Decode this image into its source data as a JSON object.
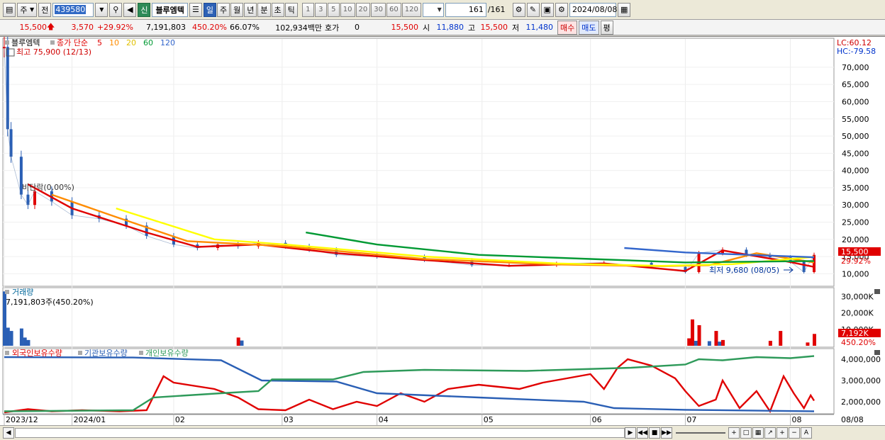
{
  "toolbar": {
    "market": "주",
    "prev_label": "전",
    "code": "439580",
    "badge": "신",
    "stock_name": "블루엠텍",
    "period_buttons": [
      "일",
      "주",
      "월",
      "년",
      "분",
      "초",
      "틱"
    ],
    "active_period": "일",
    "interval_buttons": [
      "1",
      "3",
      "5",
      "10",
      "20",
      "30",
      "60",
      "120"
    ],
    "count": "161",
    "total": "/161",
    "date": "2024/08/08"
  },
  "quote": {
    "price": "15,500",
    "change": "3,570",
    "change_pct": "+29.92%",
    "volume": "7,191,803",
    "volume_ratio": "450.20%",
    "turnover": "66.07%",
    "amount": "102,934백만",
    "hoga_label": "호가",
    "hoga_value": "0",
    "ask": "15,500",
    "open_label": "시",
    "open": "11,880",
    "high_label": "고",
    "high": "15,500",
    "low_label": "저",
    "low": "11,480",
    "buy_label": "매수",
    "sell_label": "매도",
    "avg_label": "평"
  },
  "price_panel": {
    "legend_name": "블루엠텍",
    "legend_ma": "종가 단순",
    "ma_periods": [
      "5",
      "10",
      "20",
      "60",
      "120"
    ],
    "ma_colors": [
      "#e00000",
      "#ff8c00",
      "#ffff00",
      "#009933",
      "#3366cc"
    ],
    "high_note": "최고 75,900 (12/13)",
    "low_note": "최저 9,680 (08/05)",
    "base_note": "비단락(0,00%)",
    "lc": "LC:60.12",
    "hc": "HC:-79.58",
    "price_tag": "15,500",
    "pct_tag": "29.92%"
  },
  "volume_panel": {
    "title": "거래량",
    "value": "7,191,803주(450.20%)",
    "tag": "7,192K",
    "pct_tag": "450.20%"
  },
  "holdings_panel": {
    "series_names": [
      "외국인보유수량",
      "기관보유수량",
      "개인보유수량"
    ]
  },
  "x_axis": {
    "labels": [
      "2023/12",
      "2024/01",
      "02",
      "03",
      "04",
      "05",
      "06",
      "07",
      "08"
    ],
    "right_label": "08/08"
  },
  "chart_data": [
    {
      "type": "candlestick",
      "title": "",
      "ylim": [
        7000,
        78000
      ],
      "y_ticks": [
        "70,000",
        "65,000",
        "60,000",
        "55,000",
        "50,000",
        "45,000",
        "40,000",
        "35,000",
        "30,000",
        "25,000",
        "20,000",
        "15,000",
        "10,000"
      ],
      "y_tick_values": [
        70000,
        65000,
        60000,
        55000,
        50000,
        45000,
        40000,
        35000,
        30000,
        25000,
        20000,
        15000,
        10000
      ],
      "x_start": "2023/12/13",
      "close_path": [
        {
          "d": "2023/12/13",
          "v": 75900
        },
        {
          "d": "2023/12/14",
          "v": 52000
        },
        {
          "d": "2023/12/15",
          "v": 44000
        },
        {
          "d": "2023/12/18",
          "v": 33000
        },
        {
          "d": "2023/12/20",
          "v": 30000
        },
        {
          "d": "2023/12/22",
          "v": 34000
        },
        {
          "d": "2023/12/27",
          "v": 31000
        },
        {
          "d": "2024/01/02",
          "v": 27000
        },
        {
          "d": "2024/01/10",
          "v": 26000
        },
        {
          "d": "2024/01/18",
          "v": 24000
        },
        {
          "d": "2024/01/24",
          "v": 21000
        },
        {
          "d": "2024/02/01",
          "v": 18500
        },
        {
          "d": "2024/02/08",
          "v": 17500
        },
        {
          "d": "2024/02/14",
          "v": 18500
        },
        {
          "d": "2024/02/20",
          "v": 18000
        },
        {
          "d": "2024/02/26",
          "v": 19000
        },
        {
          "d": "2024/03/05",
          "v": 18000
        },
        {
          "d": "2024/03/12",
          "v": 17000
        },
        {
          "d": "2024/03/20",
          "v": 15500
        },
        {
          "d": "2024/04/01",
          "v": 15000
        },
        {
          "d": "2024/04/15",
          "v": 14000
        },
        {
          "d": "2024/04/29",
          "v": 12500
        },
        {
          "d": "2024/05/10",
          "v": 12500
        },
        {
          "d": "2024/05/24",
          "v": 13000
        },
        {
          "d": "2024/06/07",
          "v": 13200
        },
        {
          "d": "2024/06/21",
          "v": 12000
        },
        {
          "d": "2024/07/01",
          "v": 10500
        },
        {
          "d": "2024/07/05",
          "v": 16000
        },
        {
          "d": "2024/07/12",
          "v": 17000
        },
        {
          "d": "2024/07/19",
          "v": 15500
        },
        {
          "d": "2024/07/26",
          "v": 14800
        },
        {
          "d": "2024/08/01",
          "v": 13500
        },
        {
          "d": "2024/08/05",
          "v": 10500
        },
        {
          "d": "2024/08/08",
          "v": 15500
        }
      ],
      "series": [
        {
          "name": "5",
          "color": "#e00000",
          "points": [
            {
              "d": "2023/12/20",
              "v": 36000
            },
            {
              "d": "2024/01/02",
              "v": 29000
            },
            {
              "d": "2024/01/24",
              "v": 22000
            },
            {
              "d": "2024/02/08",
              "v": 17800
            },
            {
              "d": "2024/02/26",
              "v": 18500
            },
            {
              "d": "2024/03/20",
              "v": 16000
            },
            {
              "d": "2024/04/15",
              "v": 14000
            },
            {
              "d": "2024/05/10",
              "v": 12300
            },
            {
              "d": "2024/06/07",
              "v": 13000
            },
            {
              "d": "2024/07/01",
              "v": 10800
            },
            {
              "d": "2024/07/12",
              "v": 16800
            },
            {
              "d": "2024/08/01",
              "v": 13400
            },
            {
              "d": "2024/08/08",
              "v": 12000
            }
          ]
        },
        {
          "name": "10",
          "color": "#ff8c00",
          "points": [
            {
              "d": "2023/12/27",
              "v": 33000
            },
            {
              "d": "2024/01/15",
              "v": 26500
            },
            {
              "d": "2024/02/05",
              "v": 19500
            },
            {
              "d": "2024/03/05",
              "v": 18000
            },
            {
              "d": "2024/04/15",
              "v": 14300
            },
            {
              "d": "2024/05/24",
              "v": 12700
            },
            {
              "d": "2024/06/24",
              "v": 12200
            },
            {
              "d": "2024/07/08",
              "v": 12500
            },
            {
              "d": "2024/07/22",
              "v": 16000
            },
            {
              "d": "2024/08/08",
              "v": 13300
            }
          ]
        },
        {
          "name": "20",
          "color": "#ffff00",
          "points": [
            {
              "d": "2024/01/15",
              "v": 29000
            },
            {
              "d": "2024/02/13",
              "v": 20000
            },
            {
              "d": "2024/03/05",
              "v": 18500
            },
            {
              "d": "2024/04/15",
              "v": 15000
            },
            {
              "d": "2024/05/24",
              "v": 13000
            },
            {
              "d": "2024/06/24",
              "v": 12300
            },
            {
              "d": "2024/07/15",
              "v": 12800
            },
            {
              "d": "2024/08/08",
              "v": 14900
            }
          ]
        },
        {
          "name": "60",
          "color": "#009933",
          "points": [
            {
              "d": "2024/03/11",
              "v": 22000
            },
            {
              "d": "2024/04/01",
              "v": 18500
            },
            {
              "d": "2024/05/01",
              "v": 15500
            },
            {
              "d": "2024/06/03",
              "v": 14300
            },
            {
              "d": "2024/07/01",
              "v": 13300
            },
            {
              "d": "2024/08/08",
              "v": 13700
            }
          ]
        },
        {
          "name": "120",
          "color": "#3366cc",
          "points": [
            {
              "d": "2024/06/13",
              "v": 17500
            },
            {
              "d": "2024/07/01",
              "v": 16200
            },
            {
              "d": "2024/08/08",
              "v": 14800
            }
          ]
        }
      ]
    },
    {
      "type": "bar",
      "title": "거래량",
      "ylim": [
        0,
        34000000
      ],
      "y_ticks": [
        "30,000K",
        "20,000K",
        "10,000K"
      ],
      "y_tick_values": [
        30000000,
        20000000,
        10000000
      ],
      "bars": [
        {
          "d": "2023/12/13",
          "v": 33000000,
          "c": "#2a5fb5"
        },
        {
          "d": "2023/12/14",
          "v": 11000000,
          "c": "#2a5fb5"
        },
        {
          "d": "2023/12/15",
          "v": 9000000,
          "c": "#2a5fb5"
        },
        {
          "d": "2023/12/18",
          "v": 10500000,
          "c": "#2a5fb5"
        },
        {
          "d": "2023/12/19",
          "v": 5000000,
          "c": "#2a5fb5"
        },
        {
          "d": "2023/12/20",
          "v": 3500000,
          "c": "#2a5fb5"
        },
        {
          "d": "2024/02/20",
          "v": 5000000,
          "c": "#e00000"
        },
        {
          "d": "2024/02/21",
          "v": 3200000,
          "c": "#2a5fb5"
        },
        {
          "d": "2024/07/02",
          "v": 4500000,
          "c": "#e00000"
        },
        {
          "d": "2024/07/03",
          "v": 16000000,
          "c": "#e00000"
        },
        {
          "d": "2024/07/04",
          "v": 3000000,
          "c": "#2a5fb5"
        },
        {
          "d": "2024/07/05",
          "v": 12500000,
          "c": "#e00000"
        },
        {
          "d": "2024/07/08",
          "v": 2800000,
          "c": "#2a5fb5"
        },
        {
          "d": "2024/07/10",
          "v": 9000000,
          "c": "#e00000"
        },
        {
          "d": "2024/07/11",
          "v": 2500000,
          "c": "#2a5fb5"
        },
        {
          "d": "2024/07/12",
          "v": 3500000,
          "c": "#e00000"
        },
        {
          "d": "2024/07/26",
          "v": 3000000,
          "c": "#e00000"
        },
        {
          "d": "2024/07/29",
          "v": 9000000,
          "c": "#e00000"
        },
        {
          "d": "2024/08/06",
          "v": 2000000,
          "c": "#e00000"
        },
        {
          "d": "2024/08/08",
          "v": 7191803,
          "c": "#e00000"
        }
      ]
    },
    {
      "type": "line",
      "title": "",
      "ylim": [
        1500000,
        4400000
      ],
      "y_ticks": [
        "4,000,000",
        "3,000,000",
        "2,000,000"
      ],
      "y_tick_values": [
        4000000,
        3000000,
        2000000
      ],
      "series": [
        {
          "name": "외국인보유수량",
          "color": "#e00000",
          "points": [
            {
              "d": "2023/12/13",
              "v": 1500000
            },
            {
              "d": "2023/12/20",
              "v": 1650000
            },
            {
              "d": "2023/12/27",
              "v": 1550000
            },
            {
              "d": "2024/01/05",
              "v": 1600000
            },
            {
              "d": "2024/01/16",
              "v": 1550000
            },
            {
              "d": "2024/01/24",
              "v": 1600000
            },
            {
              "d": "2024/01/29",
              "v": 3200000
            },
            {
              "d": "2024/02/01",
              "v": 2900000
            },
            {
              "d": "2024/02/13",
              "v": 2600000
            },
            {
              "d": "2024/02/20",
              "v": 2200000
            },
            {
              "d": "2024/02/26",
              "v": 1650000
            },
            {
              "d": "2024/03/05",
              "v": 1600000
            },
            {
              "d": "2024/03/12",
              "v": 2100000
            },
            {
              "d": "2024/03/19",
              "v": 1650000
            },
            {
              "d": "2024/03/26",
              "v": 2000000
            },
            {
              "d": "2024/04/01",
              "v": 1800000
            },
            {
              "d": "2024/04/08",
              "v": 2400000
            },
            {
              "d": "2024/04/15",
              "v": 2000000
            },
            {
              "d": "2024/04/22",
              "v": 2600000
            },
            {
              "d": "2024/05/01",
              "v": 2800000
            },
            {
              "d": "2024/05/13",
              "v": 2600000
            },
            {
              "d": "2024/05/20",
              "v": 2900000
            },
            {
              "d": "2024/05/27",
              "v": 3100000
            },
            {
              "d": "2024/06/03",
              "v": 3300000
            },
            {
              "d": "2024/06/07",
              "v": 2600000
            },
            {
              "d": "2024/06/11",
              "v": 3600000
            },
            {
              "d": "2024/06/14",
              "v": 4000000
            },
            {
              "d": "2024/06/21",
              "v": 3700000
            },
            {
              "d": "2024/06/28",
              "v": 3100000
            },
            {
              "d": "2024/07/01",
              "v": 2500000
            },
            {
              "d": "2024/07/05",
              "v": 1800000
            },
            {
              "d": "2024/07/10",
              "v": 2100000
            },
            {
              "d": "2024/07/12",
              "v": 3000000
            },
            {
              "d": "2024/07/17",
              "v": 1700000
            },
            {
              "d": "2024/07/22",
              "v": 2500000
            },
            {
              "d": "2024/07/26",
              "v": 1550000
            },
            {
              "d": "2024/07/30",
              "v": 3200000
            },
            {
              "d": "2024/08/02",
              "v": 2400000
            },
            {
              "d": "2024/08/05",
              "v": 1700000
            },
            {
              "d": "2024/08/07",
              "v": 2300000
            },
            {
              "d": "2024/08/08",
              "v": 2050000
            }
          ]
        },
        {
          "name": "기관보유수량",
          "color": "#2a5fb5",
          "points": [
            {
              "d": "2023/12/13",
              "v": 4100000
            },
            {
              "d": "2024/01/20",
              "v": 4080000
            },
            {
              "d": "2024/02/15",
              "v": 3950000
            },
            {
              "d": "2024/02/27",
              "v": 3000000
            },
            {
              "d": "2024/03/20",
              "v": 2950000
            },
            {
              "d": "2024/04/01",
              "v": 2400000
            },
            {
              "d": "2024/05/01",
              "v": 2200000
            },
            {
              "d": "2024/06/01",
              "v": 2000000
            },
            {
              "d": "2024/06/10",
              "v": 1700000
            },
            {
              "d": "2024/07/01",
              "v": 1620000
            },
            {
              "d": "2024/08/08",
              "v": 1550000
            }
          ]
        },
        {
          "name": "개인보유수량",
          "color": "#2e9a5a",
          "points": [
            {
              "d": "2023/12/13",
              "v": 1550000
            },
            {
              "d": "2024/01/20",
              "v": 1600000
            },
            {
              "d": "2024/01/26",
              "v": 2200000
            },
            {
              "d": "2024/02/15",
              "v": 2400000
            },
            {
              "d": "2024/02/26",
              "v": 2500000
            },
            {
              "d": "2024/03/01",
              "v": 3050000
            },
            {
              "d": "2024/03/19",
              "v": 3050000
            },
            {
              "d": "2024/03/28",
              "v": 3400000
            },
            {
              "d": "2024/04/15",
              "v": 3500000
            },
            {
              "d": "2024/05/15",
              "v": 3450000
            },
            {
              "d": "2024/06/15",
              "v": 3600000
            },
            {
              "d": "2024/07/01",
              "v": 3750000
            },
            {
              "d": "2024/07/05",
              "v": 4000000
            },
            {
              "d": "2024/07/12",
              "v": 3950000
            },
            {
              "d": "2024/07/22",
              "v": 4100000
            },
            {
              "d": "2024/08/01",
              "v": 4050000
            },
            {
              "d": "2024/08/08",
              "v": 4150000
            }
          ]
        }
      ]
    }
  ]
}
